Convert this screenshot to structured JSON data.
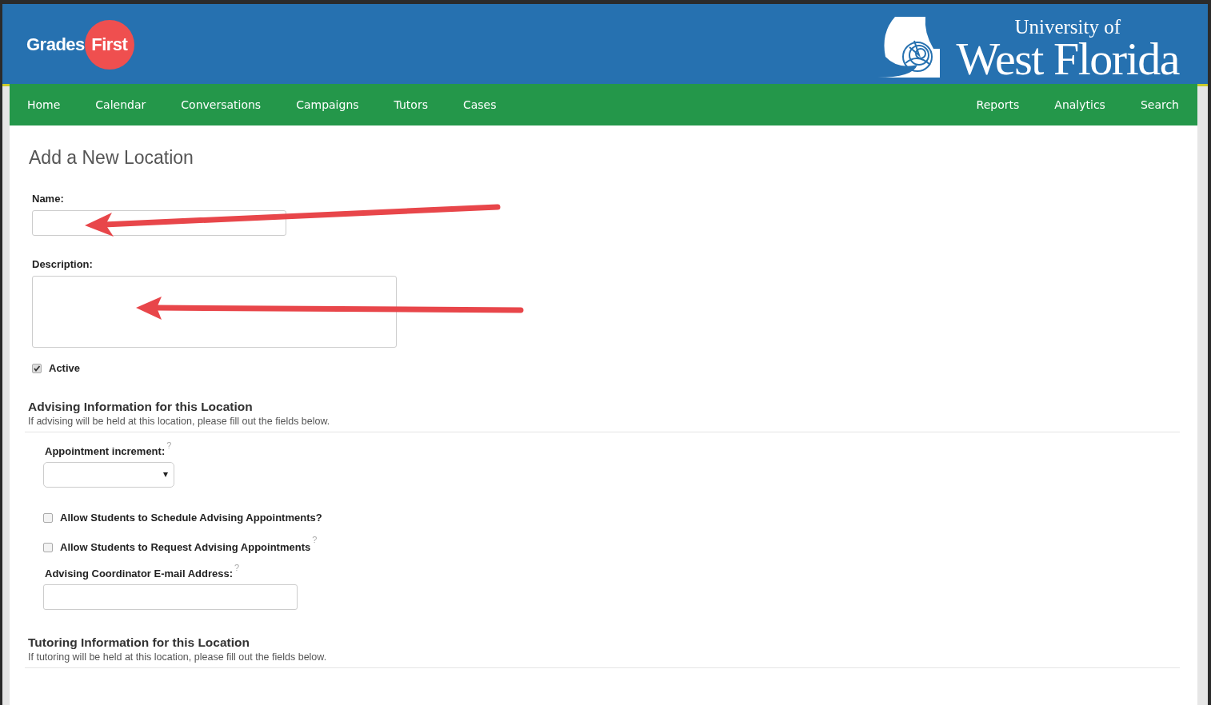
{
  "header": {
    "logo_left": {
      "word1": "Grades",
      "word2": "First"
    },
    "logo_right": {
      "line1": "University of",
      "line2": "West Florida"
    }
  },
  "nav": {
    "left": [
      "Home",
      "Calendar",
      "Conversations",
      "Campaigns",
      "Tutors",
      "Cases"
    ],
    "right": [
      "Reports",
      "Analytics",
      "Search"
    ]
  },
  "page_title": "Add a New Location",
  "fields": [
    {
      "kind": "text",
      "label": "Name:"
    },
    {
      "kind": "textarea",
      "label": "Description:"
    }
  ],
  "active": {
    "label": "Active",
    "checked": true
  },
  "sections": [
    {
      "title": "Advising Information for this Location",
      "subtitle": "If advising will be held at this location, please fill out the fields below.",
      "items": [
        {
          "kind": "select",
          "label": "Appointment increment:",
          "help": "?"
        },
        {
          "kind": "checkbox",
          "label": "Allow Students to Schedule Advising Appointments?",
          "checked": false
        },
        {
          "kind": "checkbox",
          "label": "Allow Students to Request Advising Appointments",
          "checked": false,
          "help": "?"
        },
        {
          "kind": "text",
          "label": "Advising Coordinator E-mail Address:",
          "help": "?"
        }
      ]
    },
    {
      "title": "Tutoring Information for this Location",
      "subtitle": "If tutoring will be held at this location, please fill out the fields below."
    }
  ]
}
